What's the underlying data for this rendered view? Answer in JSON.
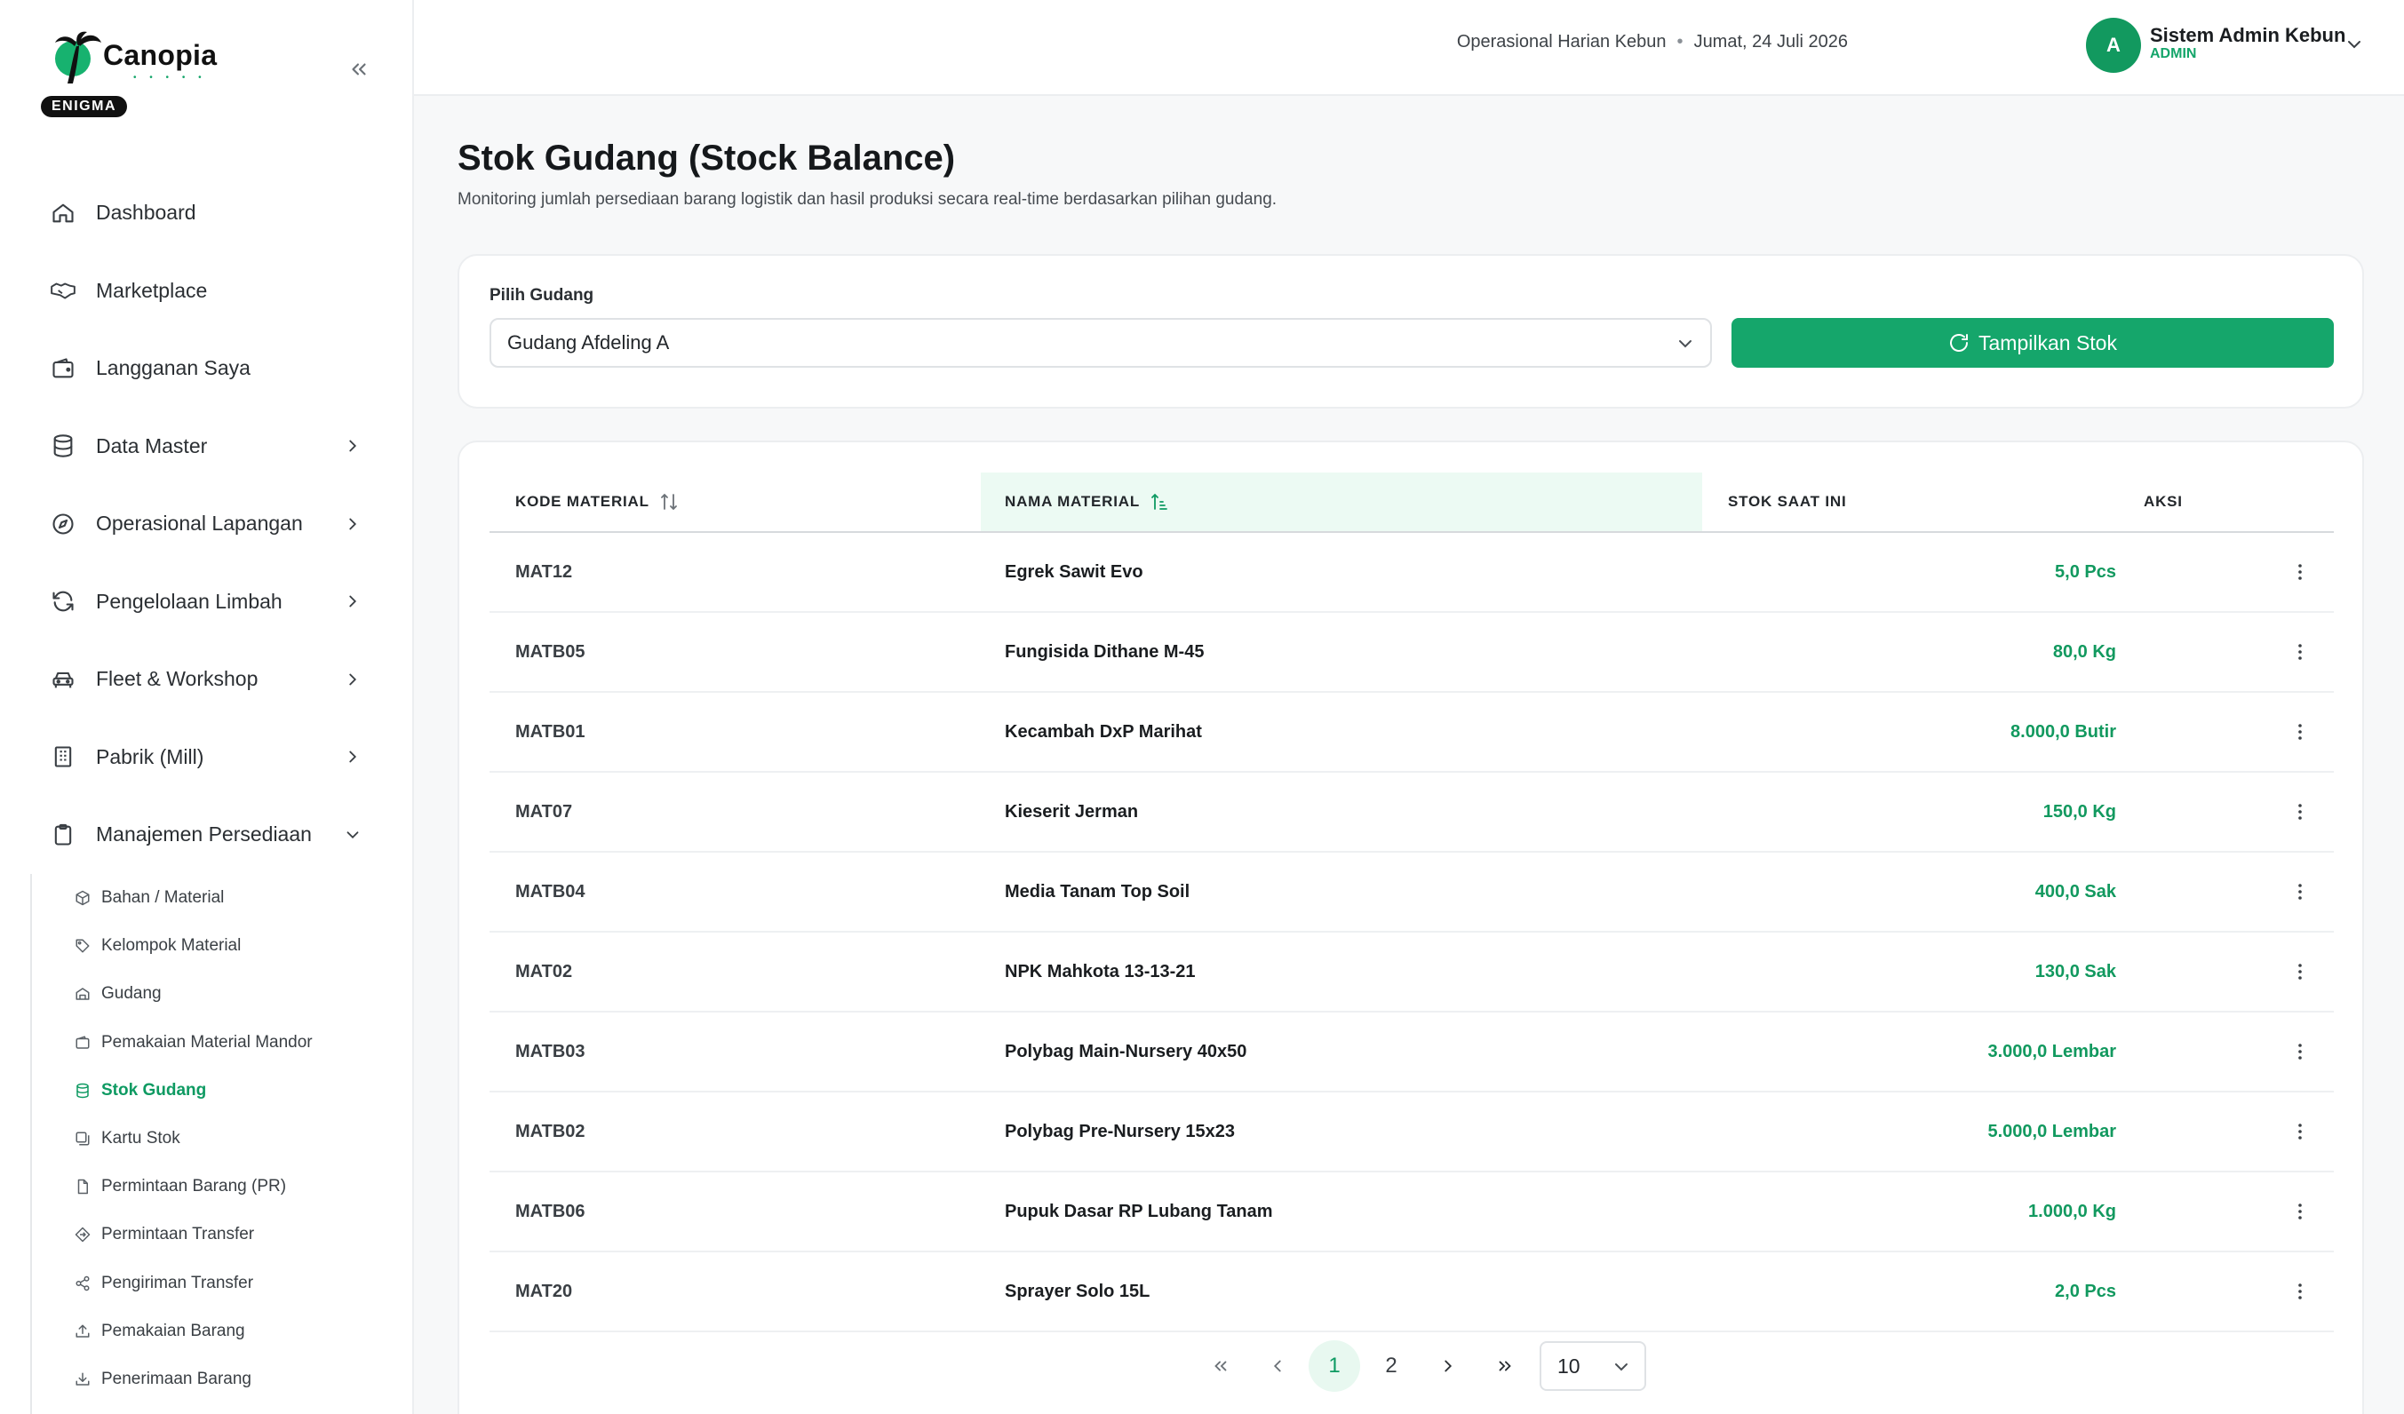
{
  "brand": {
    "name": "Canopia",
    "tag": "ENIGMA",
    "dots": "• • • • •",
    "accent": "#15a66b"
  },
  "topbar": {
    "context": "Operasional Harian Kebun",
    "separator": "•",
    "date": "Jumat, 24 Juli 2026",
    "user": {
      "initial": "A",
      "name": "Sistem Admin Kebun",
      "role": "ADMIN"
    }
  },
  "sidebar": {
    "items": [
      {
        "label": "Dashboard",
        "icon": "home-icon"
      },
      {
        "label": "Marketplace",
        "icon": "handshake-icon"
      },
      {
        "label": "Langganan Saya",
        "icon": "wallet-icon"
      },
      {
        "label": "Data Master",
        "icon": "database-icon"
      },
      {
        "label": "Operasional Lapangan",
        "icon": "compass-icon"
      },
      {
        "label": "Pengelolaan Limbah",
        "icon": "refresh-icon"
      },
      {
        "label": "Fleet & Workshop",
        "icon": "car-icon"
      },
      {
        "label": "Pabrik (Mill)",
        "icon": "building-icon"
      },
      {
        "label": "Manajemen Persediaan",
        "icon": "clipboard-icon"
      }
    ],
    "sub_items": [
      {
        "label": "Bahan / Material"
      },
      {
        "label": "Kelompok Material"
      },
      {
        "label": "Gudang"
      },
      {
        "label": "Pemakaian Material Mandor"
      },
      {
        "label": "Stok Gudang"
      },
      {
        "label": "Kartu Stok"
      },
      {
        "label": "Permintaan Barang (PR)"
      },
      {
        "label": "Permintaan Transfer"
      },
      {
        "label": "Pengiriman Transfer"
      },
      {
        "label": "Pemakaian Barang"
      },
      {
        "label": "Penerimaan Barang"
      }
    ]
  },
  "page": {
    "title": "Stok Gudang (Stock Balance)",
    "subtitle": "Monitoring jumlah persediaan barang logistik dan hasil produksi secara real-time berdasarkan pilihan gudang."
  },
  "filter": {
    "label": "Pilih Gudang",
    "selected": "Gudang Afdeling A",
    "button": "Tampilkan Stok"
  },
  "table": {
    "headers": {
      "code": "KODE MATERIAL",
      "name": "NAMA MATERIAL",
      "stock": "STOK SAAT INI",
      "action": "AKSI"
    },
    "rows": [
      {
        "code": "MAT12",
        "name": "Egrek Sawit Evo",
        "stock": "5,0 Pcs"
      },
      {
        "code": "MATB05",
        "name": "Fungisida Dithane M-45",
        "stock": "80,0 Kg"
      },
      {
        "code": "MATB01",
        "name": "Kecambah DxP Marihat",
        "stock": "8.000,0 Butir"
      },
      {
        "code": "MAT07",
        "name": "Kieserit Jerman",
        "stock": "150,0 Kg"
      },
      {
        "code": "MATB04",
        "name": "Media Tanam Top Soil",
        "stock": "400,0 Sak"
      },
      {
        "code": "MAT02",
        "name": "NPK Mahkota 13-13-21",
        "stock": "130,0 Sak"
      },
      {
        "code": "MATB03",
        "name": "Polybag Main-Nursery 40x50",
        "stock": "3.000,0 Lembar"
      },
      {
        "code": "MATB02",
        "name": "Polybag Pre-Nursery 15x23",
        "stock": "5.000,0 Lembar"
      },
      {
        "code": "MATB06",
        "name": "Pupuk Dasar RP Lubang Tanam",
        "stock": "1.000,0 Kg"
      },
      {
        "code": "MAT20",
        "name": "Sprayer Solo 15L",
        "stock": "2,0 Pcs"
      }
    ]
  },
  "pagination": {
    "pages": [
      "1",
      "2"
    ],
    "current": "1",
    "page_size": "10"
  }
}
